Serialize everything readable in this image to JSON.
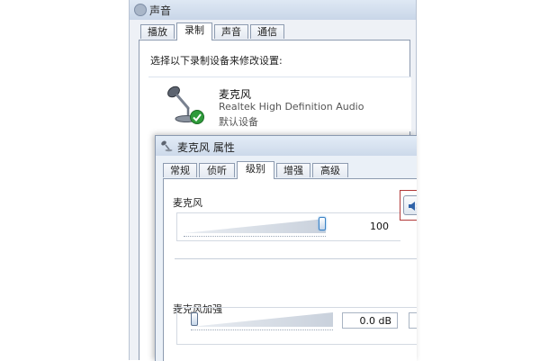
{
  "sound_window": {
    "title": "声音",
    "tabs": [
      {
        "label": "播放",
        "active": false
      },
      {
        "label": "录制",
        "active": true
      },
      {
        "label": "声音",
        "active": false
      },
      {
        "label": "通信",
        "active": false
      }
    ],
    "instruction": "选择以下录制设备来修改设置:",
    "device": {
      "name": "麦克风",
      "driver": "Realtek High Definition Audio",
      "status": "默认设备",
      "icon": "microphone-icon",
      "badge_icon": "default-check-icon",
      "badge_color": "#2e9b3a"
    }
  },
  "properties_dialog": {
    "title": "麦克风 属性",
    "tabs": [
      {
        "label": "常规",
        "active": false
      },
      {
        "label": "侦听",
        "active": false
      },
      {
        "label": "级别",
        "active": true
      },
      {
        "label": "增强",
        "active": false
      },
      {
        "label": "高级",
        "active": false
      }
    ],
    "microphone_level": {
      "label": "麦克风",
      "value": "100",
      "level_fraction": 1.0,
      "mute_button_icon": "speaker-icon",
      "highlight_color": "#b23a3a"
    },
    "microphone_boost": {
      "label": "麦克风加强",
      "value": "0.0 dB",
      "level_fraction": 0.0
    }
  }
}
